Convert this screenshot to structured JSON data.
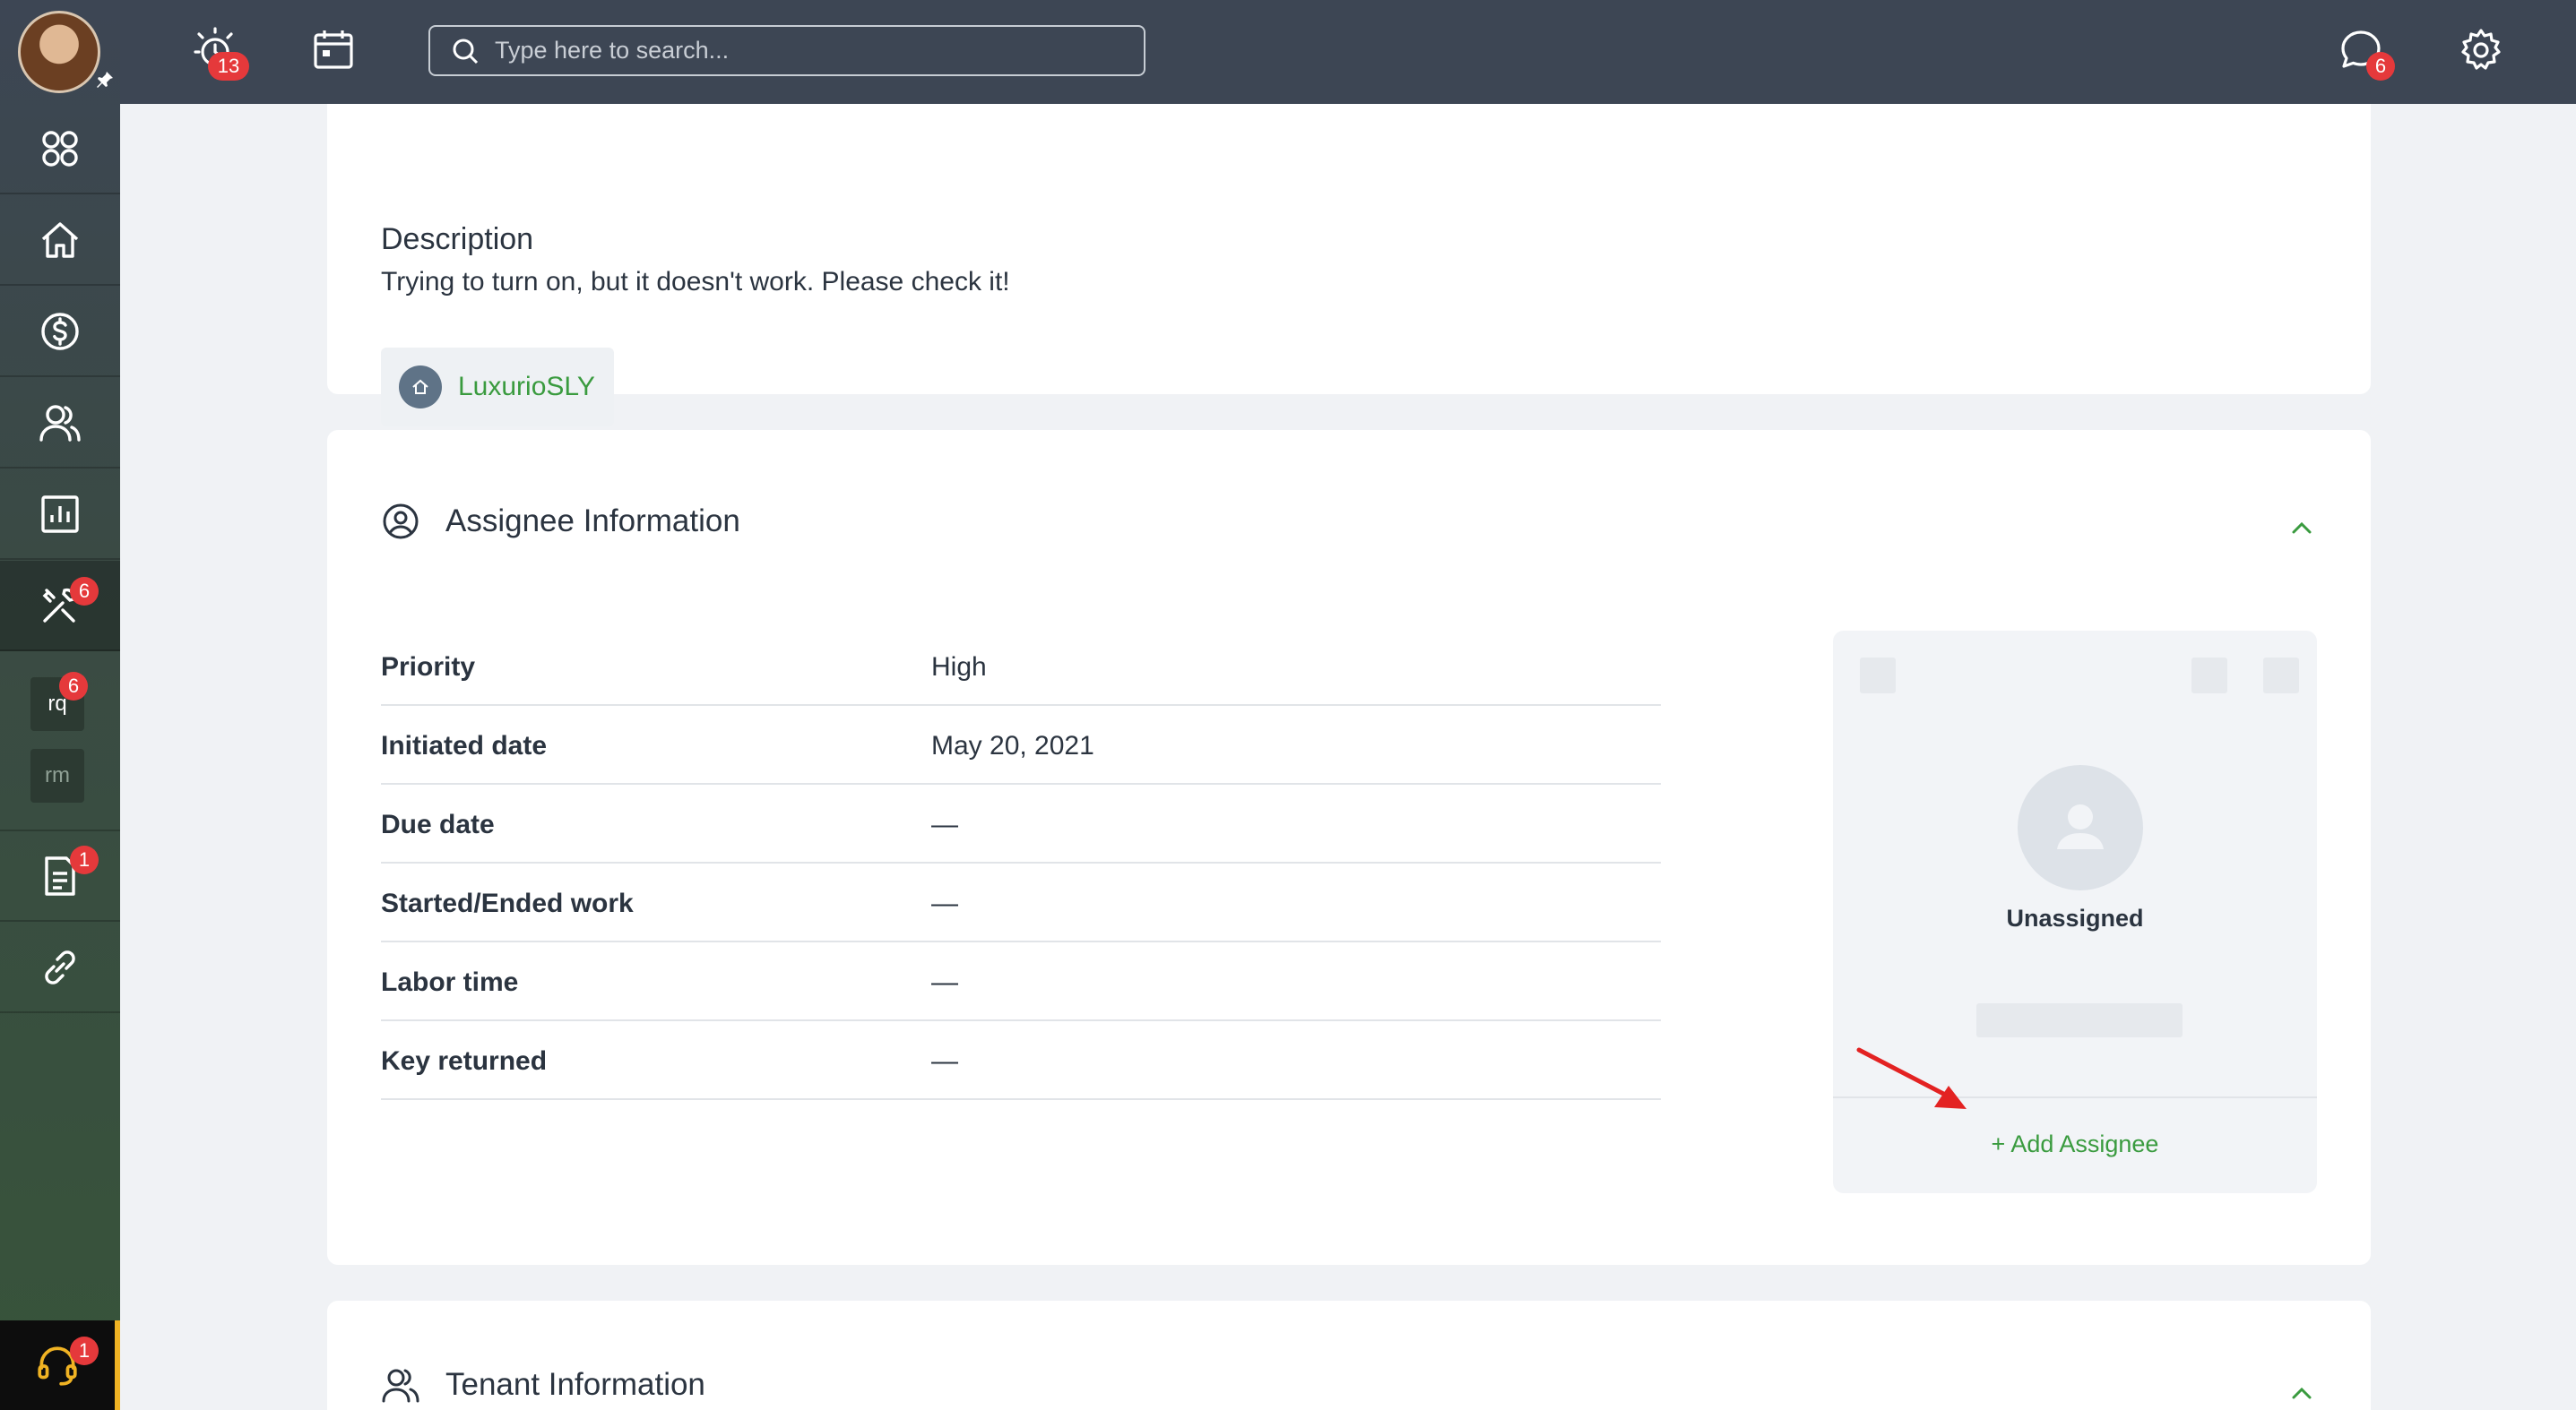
{
  "topbar": {
    "alerts_badge": "13",
    "search_placeholder": "Type here to search...",
    "chat_badge": "6"
  },
  "sidebar": {
    "maintenance_badge": "6",
    "rq_label": "rq",
    "rq_badge": "6",
    "rm_label": "rm",
    "docs_badge": "1",
    "support_badge": "1"
  },
  "description": {
    "title": "Description",
    "text": "Trying to turn on, but it doesn't work. Please check it!",
    "property_name": "LuxurioSLY"
  },
  "assignee_section": {
    "title": "Assignee Information",
    "rows": [
      {
        "label": "Priority",
        "value": "High"
      },
      {
        "label": "Initiated date",
        "value": "May 20, 2021"
      },
      {
        "label": "Due date",
        "value": "—"
      },
      {
        "label": "Started/Ended work",
        "value": "—"
      },
      {
        "label": "Labor time",
        "value": "—"
      },
      {
        "label": "Key returned",
        "value": "—"
      }
    ],
    "assignee_status": "Unassigned",
    "add_assignee_label": "+ Add Assignee"
  },
  "tenant_section": {
    "title": "Tenant Information"
  },
  "colors": {
    "topbar": "#3d4654",
    "accent_green": "#3a9b3f",
    "badge_red": "#e5393b",
    "support_yellow": "#f0b323"
  }
}
